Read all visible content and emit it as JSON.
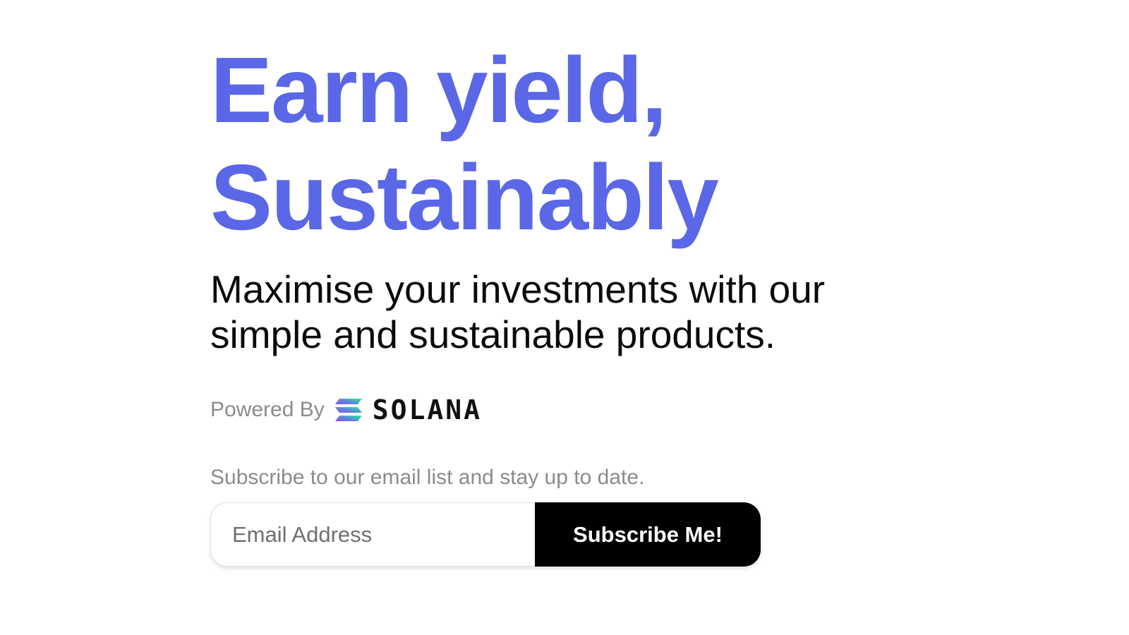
{
  "hero": {
    "headline_line1": "Earn yield,",
    "headline_line2": "Sustainably",
    "subheadline": "Maximise your investments with our simple and sustainable products."
  },
  "powered_by": {
    "label": "Powered By",
    "brand": "SOLANA",
    "logo_icon": "solana-logo-icon"
  },
  "subscribe": {
    "note": "Subscribe to our email list and stay up to date.",
    "email_placeholder": "Email Address",
    "email_value": "",
    "button_label": "Subscribe Me!"
  },
  "colors": {
    "accent": "#5a67e6",
    "button_bg": "#000000",
    "button_text": "#ffffff",
    "muted_text": "#8b8b8b"
  }
}
